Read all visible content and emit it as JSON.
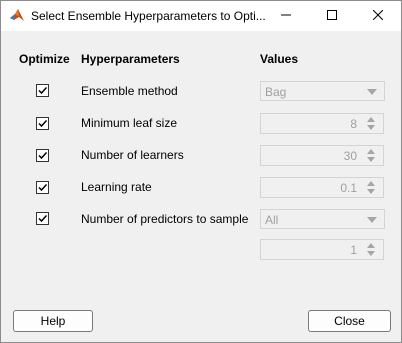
{
  "window": {
    "title": "Select Ensemble Hyperparameters to Opti..."
  },
  "headers": {
    "optimize": "Optimize",
    "hyperparameters": "Hyperparameters",
    "values": "Values"
  },
  "rows": [
    {
      "label": "Ensemble method",
      "checked": true,
      "value": "Bag"
    },
    {
      "label": "Minimum leaf size",
      "checked": true,
      "value": "8"
    },
    {
      "label": "Number of learners",
      "checked": true,
      "value": "30"
    },
    {
      "label": "Learning rate",
      "checked": true,
      "value": "0.1"
    },
    {
      "label": "Number of predictors to sample",
      "checked": true,
      "value": "All"
    }
  ],
  "extra_spinner": {
    "value": "1"
  },
  "buttons": {
    "help": "Help",
    "close": "Close"
  },
  "colors": {
    "disabled_text": "#a0a0a0",
    "background": "#f0f0f0"
  }
}
